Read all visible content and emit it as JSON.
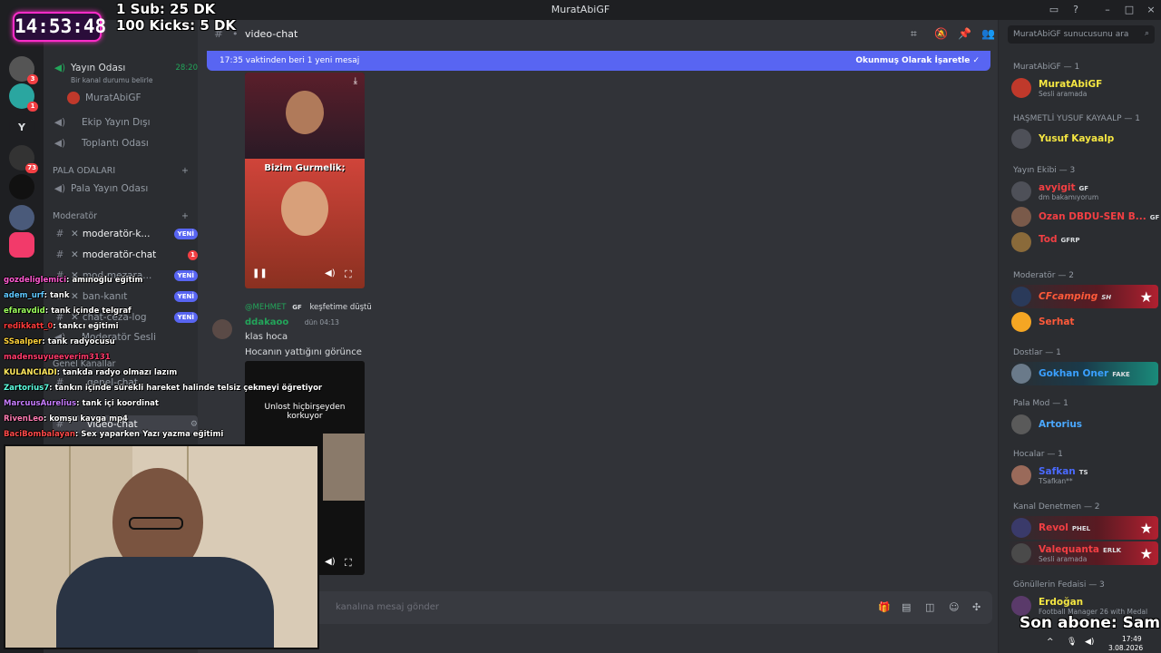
{
  "app": {
    "window_title": "MuratAbiGF"
  },
  "overlay": {
    "clock": "14:53:48",
    "goal1": "1 Sub: 25 DK",
    "goal2": "100 Kicks: 5 DK",
    "last_sub": "Son abone: Sam"
  },
  "servers": [
    {
      "label": "",
      "badge": "3"
    },
    {
      "label": "",
      "badge": "1"
    },
    {
      "label": "Y",
      "badge": ""
    },
    {
      "label": "",
      "badge": "73"
    },
    {
      "label": "",
      "badge": ""
    },
    {
      "label": "",
      "badge": ""
    },
    {
      "label": "",
      "badge": ""
    }
  ],
  "server": {
    "name": "MuratAbiGF"
  },
  "channels": {
    "voice_live": "Yayın Odası",
    "voice_live_time": "28:20",
    "voice_status": "Bir kanal durumu belirle",
    "voice_user": "MuratAbiGF",
    "crew": "Ekip Yayın Dışı",
    "meeting": "Toplantı Odası",
    "cat_pala": "PALA ODALARI",
    "pala_room": "Pala Yayın Odası",
    "cat_mod": "Moderatör",
    "mod1": "moderatör-k...",
    "mod1_badge": "YENİ",
    "mod2": "moderatör-chat",
    "mod2_badge": "1",
    "mod3": "mod-mezara...",
    "mod3_badge": "YENİ",
    "ban": "ban-kanıt",
    "ban_badge": "YENİ",
    "chatlog": "chat-ceza-log",
    "chatlog_badge": "YENİ",
    "mod_voice": "Moderatör Sesli",
    "cat_general": "Genel Kanallar",
    "general": "genel-chat",
    "video": "video-chat"
  },
  "header": {
    "channel": "video-chat"
  },
  "banner": {
    "left": "17:35 vaktinden beri 1 yeni mesaj",
    "right": "Okunmuş Olarak İşaretle"
  },
  "messages": {
    "video_caption": "Bizim Gurmelik;",
    "reply_user": "@MEHMET",
    "reply_tag": "GF",
    "reply_text": "keşfetime düştü",
    "author": "ddakaoo",
    "time": "dün 04:13",
    "line1": "klas hoca",
    "line2": "Hocanın yattığını görünce",
    "video2_caption": "Unlost hiçbirşeyden korkuyor"
  },
  "composer": {
    "placeholder": "kanalına mesaj gönder"
  },
  "search": {
    "placeholder": "MuratAbiGF sunucusunu ara"
  },
  "members": {
    "cat1": "MuratAbiGF — 1",
    "m1": "MuratAbiGF",
    "m1_status": "Sesli aramada",
    "cat2": "HAŞMETLİ YUSUF KAYAALP — 1",
    "m2": "Yusuf Kayaalp",
    "cat3": "Yayın Ekibi — 3",
    "m3": "avyigit",
    "m3_tag": "GF",
    "m3_status": "dm bakamıyorum",
    "m4": "Ozan DBDU-SEN B...",
    "m4_tag": "GF",
    "m5": "Tod",
    "m5_tag": "GFRP",
    "cat4": "Moderatör — 2",
    "m6": "CFcamping",
    "m6_tag": "SH",
    "m7": "Serhat",
    "cat5": "Dostlar — 1",
    "m8": "Gokhan Oner",
    "m8_tag": "FAKE",
    "cat6": "Pala Mod — 1",
    "m9": "Artorius",
    "cat7": "Hocalar — 1",
    "m10": "Safkan",
    "m10_tag": "TS",
    "m10_status": "TSafkan**",
    "cat8": "Kanal Denetmen — 2",
    "m11": "Revol",
    "m11_tag": "PHEL",
    "m12": "Valequanta",
    "m12_tag": "ERLK",
    "m12_status": "Sesli aramada",
    "cat9": "Gönüllerin Fedaisi — 3",
    "m13": "Erdoğan",
    "m13_status": "Football Manager 26 with Medal"
  },
  "chat_overlay": [
    {
      "user": "gozdeliglemici",
      "text": ": amınoğlu eğitim",
      "color": "#ff5ad1"
    },
    {
      "user": "adem_urf",
      "text": ": tank",
      "color": "#5ec8ff"
    },
    {
      "user": "efaravdid",
      "text": ": tank içinde telgraf",
      "color": "#9dff5e"
    },
    {
      "user": "redikkatt_0",
      "text": ": tankcı eğitimi",
      "color": "#ff3b3b"
    },
    {
      "user": "SSaalper",
      "text": ": tank radyocusu",
      "color": "#ffd23b"
    },
    {
      "user": "madensuyueeverim3131",
      "text": "",
      "color": "#ff3b6b"
    },
    {
      "user": "KULANCIADI",
      "text": ": tankda radyo olmazı lazım",
      "color": "#ffe95e"
    },
    {
      "user": "Zartorius7",
      "text": ": tankın içinde sürekli hareket halinde telsiz çekmeyi öğretiyor",
      "color": "#5effe0"
    },
    {
      "user": "MarcuusAurelius",
      "text": ": tank içi koordinat",
      "color": "#c77dff"
    },
    {
      "user": "RivenLeo",
      "text": ": komşu kavga mp4",
      "color": "#ff7db3"
    },
    {
      "user": "BaciBombalayan",
      "text": ": Sex yaparken Yazı yazma eğitimi",
      "color": "#ff4a4a"
    }
  ],
  "taskbar": {
    "time": "17:49",
    "date": "3.08.2026"
  },
  "colors": {
    "accent": "#5865f2",
    "banner": "#5865f2",
    "clock_border": "#ff2cc8"
  }
}
